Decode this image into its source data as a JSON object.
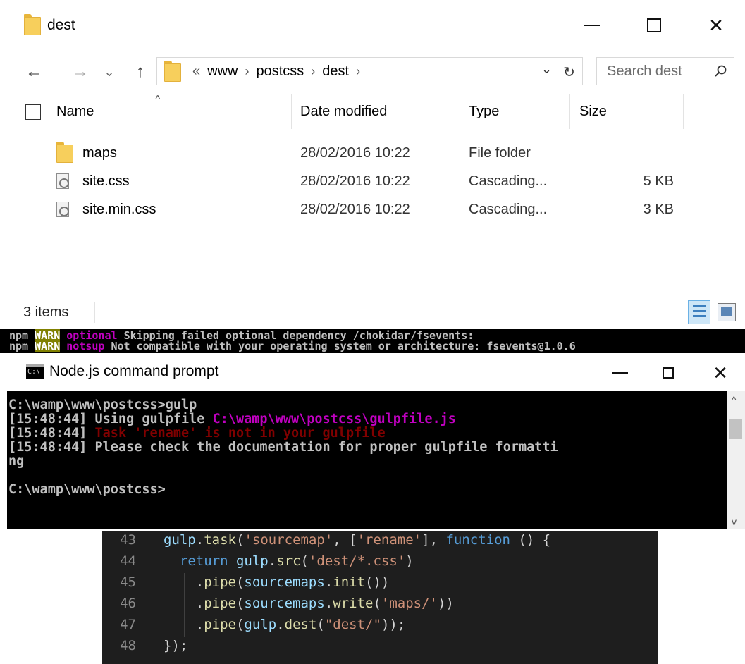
{
  "explorer": {
    "title": "dest",
    "caption_buttons": {
      "minimize": "—",
      "maximize": "☐",
      "close": "✕"
    },
    "nav": {
      "back": "←",
      "forward": "→",
      "recent": "⌄",
      "up": "↑"
    },
    "address": {
      "overflow": "«",
      "crumbs": [
        "www",
        "postcss",
        "dest"
      ],
      "separator": "›",
      "dropdown": "⌄",
      "refresh": "↻"
    },
    "search": {
      "placeholder": "Search dest"
    },
    "columns": {
      "name": "Name",
      "date": "Date modified",
      "type": "Type",
      "size": "Size"
    },
    "sort_indicator": "^",
    "files": [
      {
        "name": "maps",
        "date": "28/02/2016 10:22",
        "type": "File folder",
        "size": "",
        "icon": "folder-icon"
      },
      {
        "name": "site.css",
        "date": "28/02/2016 10:22",
        "type": "Cascading...",
        "size": "5 KB",
        "icon": "css-file-icon"
      },
      {
        "name": "site.min.css",
        "date": "28/02/2016 10:22",
        "type": "Cascading...",
        "size": "3 KB",
        "icon": "css-file-icon"
      }
    ],
    "status": "3 items"
  },
  "npm": {
    "lines": [
      {
        "prefix": "npm",
        "tag": "WARN",
        "level": "optional",
        "message": "Skipping failed optional dependency /chokidar/fsevents:"
      },
      {
        "prefix": "npm",
        "tag": "WARN",
        "level": "notsup",
        "message": "Not compatible with your operating system or architecture: fsevents@1.0.6"
      }
    ]
  },
  "console": {
    "title": "Node.js command prompt",
    "caption_buttons": {
      "minimize": "—",
      "maximize": "☐",
      "close": "✕"
    },
    "lines": {
      "l1": "C:\\wamp\\www\\postcss>gulp",
      "l2_prefix": "[15:48:44] Using gulpfile ",
      "l2_path": "C:\\wamp\\www\\postcss\\gulpfile.js",
      "l3_prefix": "[15:48:44] ",
      "l3_error": "Task 'rename' is not in your gulpfile",
      "l4": "[15:48:44] Please check the documentation for proper gulpfile formatti",
      "l5": "ng",
      "l6": "",
      "l7": "C:\\wamp\\www\\postcss>"
    },
    "scroll": {
      "up": "^",
      "down": "v"
    }
  },
  "editor": {
    "line_numbers": [
      "43",
      "44",
      "45",
      "46",
      "47",
      "48"
    ]
  },
  "colors": {
    "warn_bg": "#808000",
    "magenta": "#c000c0",
    "console_error": "#800000",
    "editor_bg": "#1e1e1e"
  }
}
